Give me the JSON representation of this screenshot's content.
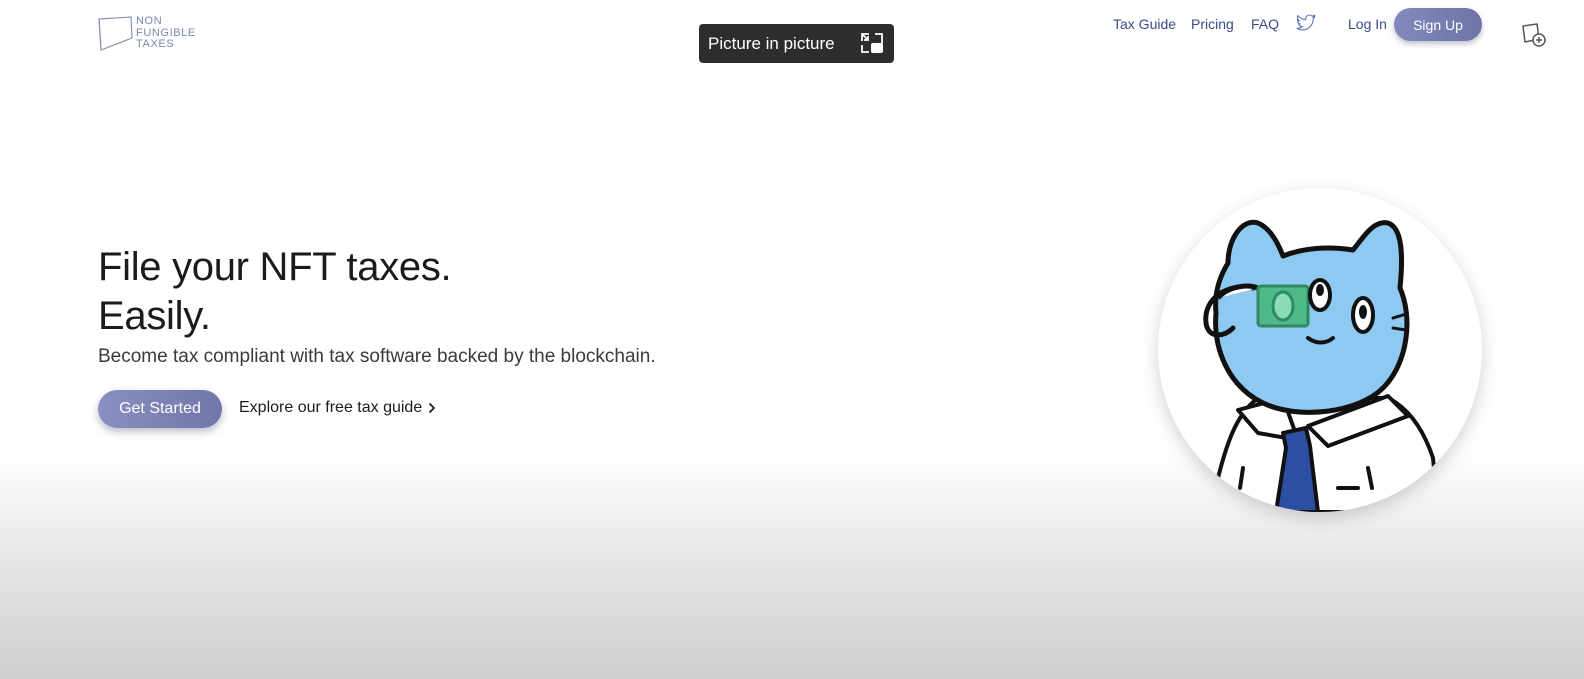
{
  "logo": {
    "line1": "NON",
    "line2": "FUNGIBLE",
    "line3": "TAXES"
  },
  "pip_tooltip": {
    "label": "Picture in picture",
    "icon": "picture-in-picture-icon"
  },
  "nav": {
    "tax_guide": "Tax Guide",
    "pricing": "Pricing",
    "faq": "FAQ",
    "twitter_icon": "twitter-icon",
    "login": "Log In",
    "signup": "Sign Up",
    "extension_icon": "add-extension-icon"
  },
  "hero": {
    "headline_line1": "File your NFT taxes.",
    "headline_line2": "Easily.",
    "subtitle": "Become tax compliant with tax software backed by the blockchain.",
    "cta": "Get Started",
    "guide_link": "Explore our free tax guide"
  },
  "colors": {
    "accent": "#7b80b4",
    "nav_text": "#3b4a8a",
    "cat_blue": "#8ec9f2",
    "tie_blue": "#2d4fa3",
    "money_green": "#4fb98a"
  }
}
